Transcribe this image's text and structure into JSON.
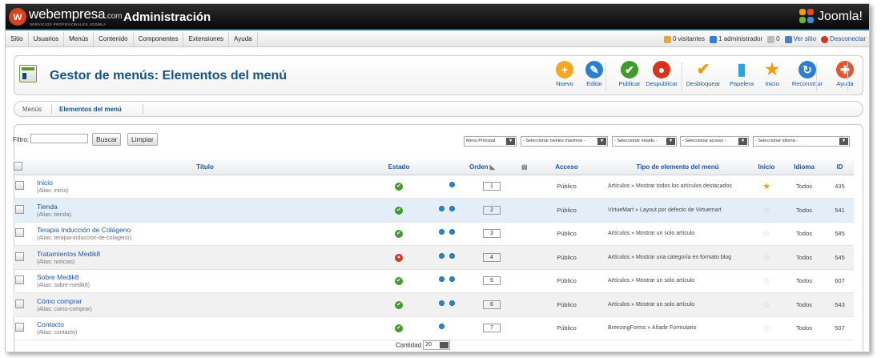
{
  "brand": {
    "name": "webempresa",
    "suffix": ".com",
    "tagline": "SERVICIOS PROFESIONALES JOOMLA",
    "admin": "Administración",
    "joomla": "Joomla!"
  },
  "menu": [
    "Sitio",
    "Usuarios",
    "Menús",
    "Contenido",
    "Componentes",
    "Extensiones",
    "Ayuda"
  ],
  "status": {
    "visitors": "0 visitantes",
    "admins": "1 administrador",
    "messages": "0",
    "view_site": "Ver sitio",
    "logout": "Desconectar"
  },
  "page": {
    "title": "Gestor de menús: Elementos del menú"
  },
  "toolbar": [
    {
      "label": "Nuevo",
      "icon": "plus-icon",
      "color": "#f5a623",
      "glyph": "+"
    },
    {
      "label": "Editar",
      "icon": "pencil-icon",
      "color": "#2a7fd4",
      "glyph": "✎"
    },
    {
      "label": "Publicar",
      "icon": "check-icon",
      "color": "#3f9b2a",
      "glyph": "✔"
    },
    {
      "label": "Despublicar",
      "icon": "stop-icon",
      "color": "#d9331e",
      "glyph": "●"
    },
    {
      "label": "Desbloquear",
      "icon": "checkin-icon",
      "color": "#f39c12",
      "glyph": "✔"
    },
    {
      "label": "Papelera",
      "icon": "trash-icon",
      "color": "#2aa5e0",
      "glyph": "▮"
    },
    {
      "label": "Inicio",
      "icon": "star-icon",
      "color": "#f39c12",
      "glyph": "★"
    },
    {
      "label": "Reconstruir",
      "icon": "refresh-icon",
      "color": "#2a7fd4",
      "glyph": "↻"
    },
    {
      "label": "Ayuda",
      "icon": "help-icon",
      "color": "#e8552b",
      "glyph": "✚"
    }
  ],
  "submenu": {
    "menus": "Menús",
    "items": "Elementos del menú"
  },
  "filter": {
    "label": "Filtro:",
    "value": "",
    "search": "Buscar",
    "clear": "Limpiar",
    "selects": [
      "Menu Principal",
      "- Seleccionar niveles máximos -",
      "- Seleccionar estado -",
      "- Seleccionar acceso -",
      "- Seleccionar idioma -"
    ]
  },
  "columns": {
    "title": "Título",
    "state": "Estado",
    "order": "Orden",
    "access": "Acceso",
    "type": "Tipo de elemento del menú",
    "home": "Inicio",
    "lang": "Idioma",
    "id": "ID"
  },
  "rows": [
    {
      "title": "Inicio",
      "alias": "(Alias: inicio)",
      "published": true,
      "up": false,
      "down": true,
      "order": "1",
      "access": "Público",
      "type": "Artículos » Mostrar todos los artículos destacados",
      "home": true,
      "lang": "Todos",
      "id": "435"
    },
    {
      "title": "Tienda",
      "alias": "(Alias: tienda)",
      "published": true,
      "up": true,
      "down": true,
      "order": "2",
      "access": "Público",
      "type": "VirtueMart » Layout por defecto de Virtuemart",
      "home": false,
      "lang": "Todos",
      "id": "541"
    },
    {
      "title": "Terapia Inducción de Colágeno",
      "alias": "(Alias: terapia-induccion-de-colageno)",
      "published": true,
      "up": true,
      "down": true,
      "order": "3",
      "access": "Público",
      "type": "Artículos » Mostrar un solo artículo",
      "home": false,
      "lang": "Todos",
      "id": "585"
    },
    {
      "title": "Tratamientos Medik8",
      "alias": "(Alias: noticias)",
      "published": false,
      "up": true,
      "down": true,
      "order": "4",
      "access": "Público",
      "type": "Artículos » Mostrar una categoría en formato blog",
      "home": false,
      "lang": "Todos",
      "id": "545"
    },
    {
      "title": "Sobre Medik8",
      "alias": "(Alias: sobre-medik8)",
      "published": true,
      "up": true,
      "down": true,
      "order": "5",
      "access": "Público",
      "type": "Artículos » Mostrar un solo artículo",
      "home": false,
      "lang": "Todos",
      "id": "607"
    },
    {
      "title": "Cómo comprar",
      "alias": "(Alias: como-comprar)",
      "published": true,
      "up": true,
      "down": true,
      "order": "6",
      "access": "Público",
      "type": "Artículos » Mostrar un solo artículo",
      "home": false,
      "lang": "Todos",
      "id": "543"
    },
    {
      "title": "Contacto",
      "alias": "(Alias: contacto)",
      "published": true,
      "up": true,
      "down": false,
      "order": "7",
      "access": "Público",
      "type": "BreezingForms » Añadir Formulario",
      "home": false,
      "lang": "Todos",
      "id": "507"
    }
  ],
  "footer": {
    "label": "Cantidad",
    "value": "20"
  }
}
